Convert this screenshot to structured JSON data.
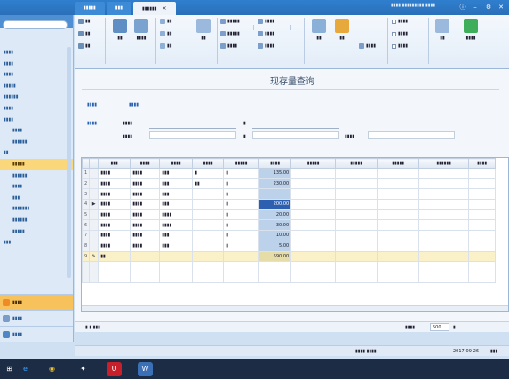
{
  "titlebar": {
    "tabs": [
      {
        "label": "▮▮▮▮▮",
        "active": false
      },
      {
        "label": "▮▮▮",
        "active": false
      },
      {
        "label": "▮▮▮▮▮▮",
        "active": true
      }
    ],
    "window_title": "▮▮▮▮ ▮▮▮▮▮▮▮▮▮ ▮▮▮▮",
    "controls": [
      "ⓘ",
      "–",
      "⚙",
      "✕"
    ]
  },
  "sidebar": {
    "items": [
      {
        "label": "▮▮▮▮",
        "level": 1
      },
      {
        "label": "▮▮▮▮",
        "level": 1
      },
      {
        "label": "▮▮▮▮",
        "level": 1
      },
      {
        "label": "▮▮▮▮▮",
        "level": 1
      },
      {
        "label": "▮▮▮▮▮▮",
        "level": 1
      },
      {
        "label": "▮▮▮▮",
        "level": 1
      },
      {
        "label": "▮▮▮▮",
        "level": 1
      },
      {
        "label": "▮▮▮▮",
        "level": 2
      },
      {
        "label": "▮▮▮▮▮▮",
        "level": 2
      },
      {
        "label": "▮▮",
        "level": 1
      },
      {
        "label": "▮▮▮▮▮",
        "level": 2,
        "selected": true
      },
      {
        "label": "▮▮▮▮▮▮",
        "level": 2
      },
      {
        "label": "▮▮▮▮",
        "level": 2
      },
      {
        "label": "▮▮▮",
        "level": 2
      },
      {
        "label": "▮▮▮▮▮▮▮",
        "level": 2
      },
      {
        "label": "▮▮▮▮▮▮",
        "level": 2
      },
      {
        "label": "▮▮▮▮▮",
        "level": 2
      },
      {
        "label": "▮▮▮",
        "level": 1
      }
    ],
    "bottom": [
      {
        "label": "▮▮▮▮",
        "selected": true,
        "color": "#f08a24"
      },
      {
        "label": "▮▮▮▮",
        "selected": false,
        "color": "#7a9cc6"
      },
      {
        "label": "▮▮▮▮",
        "selected": false,
        "color": "#4f86c6"
      }
    ]
  },
  "ribbon": {
    "small_buttons": [
      "▮▮",
      "▮▮",
      "▮▮",
      "▮▮",
      "▮▮",
      "▮▮",
      "▮▮▮▮▮",
      "▮▮▮▮▮",
      "▮▮▮▮",
      "▮▮▮▮",
      "▮▮▮▮",
      "▮▮▮▮",
      "▮▮▮▮",
      "▮▮▮▮",
      "▮▮▮▮"
    ],
    "big_buttons": [
      "▮▮",
      "▮▮▮▮",
      "▮▮",
      "▮▮",
      "▮▮",
      "▮▮",
      "▮▮▮▮"
    ],
    "checkboxes": [
      "▮▮▮▮",
      "▮▮▮▮",
      "▮▮▮▮"
    ]
  },
  "page": {
    "title": "现存量查询",
    "query_plan_label": "▮▮▮▮",
    "query_plan_value": "▮▮▮▮",
    "query_cond_label": "▮▮▮▮",
    "fields": [
      {
        "label": "▮▮▮▮"
      },
      {
        "label": "▮"
      },
      {
        "label": "▮▮▮▮"
      },
      {
        "label": "▮"
      },
      {
        "label": "▮▮▮▮"
      }
    ]
  },
  "grid": {
    "columns": [
      "▮▮▮",
      "▮▮▮▮",
      "▮▮▮▮",
      "▮▮▮▮",
      "▮▮▮▮▮",
      "▮▮▮▮",
      "▮▮▮▮▮",
      "▮▮▮▮▮",
      "▮▮▮▮▮",
      "▮▮▮▮▮▮",
      "▮▮▮▮"
    ],
    "rows": [
      {
        "n": "1",
        "ind": "",
        "c": [
          "▮▮▮▮",
          "▮▮▮▮",
          "▮▮▮",
          "▮",
          "▮",
          "135.00",
          "",
          "",
          "",
          "",
          ""
        ]
      },
      {
        "n": "2",
        "ind": "",
        "c": [
          "▮▮▮▮",
          "▮▮▮▮",
          "▮▮▮",
          "▮▮",
          "▮",
          "230.00",
          "",
          "",
          "",
          "",
          ""
        ]
      },
      {
        "n": "3",
        "ind": "",
        "c": [
          "▮▮▮▮",
          "▮▮▮▮",
          "▮▮▮",
          "",
          "▮",
          "",
          "",
          "",
          "",
          "",
          ""
        ]
      },
      {
        "n": "4",
        "ind": "▶",
        "c": [
          "▮▮▮▮",
          "▮▮▮▮",
          "▮▮▮",
          "",
          "▮",
          "200.00",
          "",
          "",
          "",
          "",
          ""
        ],
        "selected": true
      },
      {
        "n": "5",
        "ind": "",
        "c": [
          "▮▮▮▮",
          "▮▮▮▮",
          "▮▮▮▮",
          "",
          "▮",
          "20.00",
          "",
          "",
          "",
          "",
          ""
        ]
      },
      {
        "n": "6",
        "ind": "",
        "c": [
          "▮▮▮▮",
          "▮▮▮▮",
          "▮▮▮▮",
          "",
          "▮",
          "30.00",
          "",
          "",
          "",
          "",
          ""
        ]
      },
      {
        "n": "7",
        "ind": "",
        "c": [
          "▮▮▮▮",
          "▮▮▮▮",
          "▮▮▮",
          "",
          "▮",
          "10.00",
          "",
          "",
          "",
          "",
          ""
        ]
      },
      {
        "n": "8",
        "ind": "",
        "c": [
          "▮▮▮▮",
          "▮▮▮▮",
          "▮▮▮",
          "",
          "▮",
          "5.00",
          "",
          "",
          "",
          "",
          ""
        ]
      },
      {
        "n": "9",
        "ind": "✎",
        "c": [
          "▮▮",
          "",
          "",
          "",
          "",
          "590.00",
          "",
          "",
          "",
          "",
          ""
        ],
        "total": true
      }
    ]
  },
  "pager": {
    "left": "▮ ▮ ▮▮▮",
    "label": "▮▮▮▮",
    "value": "500",
    "unit": "▮"
  },
  "status": {
    "user": "▮▮▮▮ ▮▮▮▮",
    "date1": "2017-09-26",
    "date2": "▮▮▮"
  },
  "taskbar": {
    "icons": [
      {
        "name": "start-icon",
        "glyph": "⊞",
        "bg": "#1c2c44"
      },
      {
        "name": "ie-icon",
        "glyph": "e",
        "bg": "#1c2c44"
      },
      {
        "name": "chrome-icon",
        "glyph": "◉",
        "bg": "#1c2c44"
      },
      {
        "name": "qq-icon",
        "glyph": "✦",
        "bg": "#1c2c44"
      },
      {
        "name": "app-u8-icon",
        "glyph": "U",
        "bg": "#c8202b"
      },
      {
        "name": "app-w-icon",
        "glyph": "W",
        "bg": "#3b6fb6"
      }
    ]
  },
  "colors": {
    "titlebar": "#2f7fcf",
    "grid_qty": "#bcd2ea",
    "selected_cell": "#2d5fb0",
    "total_row": "#fbf1c8",
    "sidebar_selected": "#f9d77a"
  }
}
